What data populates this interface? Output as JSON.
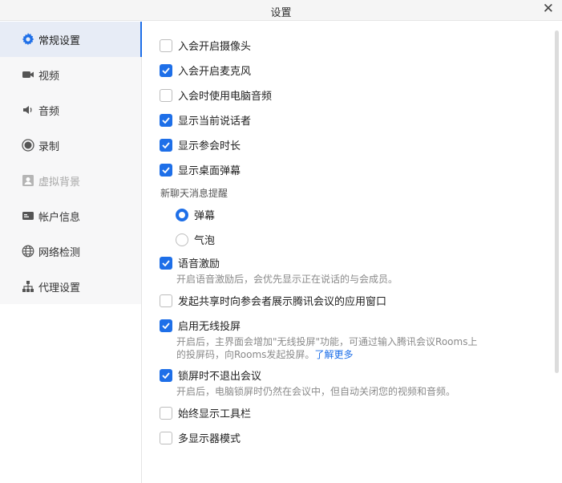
{
  "window": {
    "title": "设置"
  },
  "sidebar": {
    "items": [
      {
        "label": "常规设置",
        "icon": "gear-icon",
        "active": true
      },
      {
        "label": "视频",
        "icon": "video-camera-icon"
      },
      {
        "label": "音频",
        "icon": "speaker-icon"
      },
      {
        "label": "录制",
        "icon": "record-icon"
      },
      {
        "label": "虚拟背景",
        "icon": "virtual-background-icon",
        "disabled": true
      },
      {
        "label": "帐户信息",
        "icon": "account-card-icon"
      },
      {
        "label": "网络检测",
        "icon": "globe-icon"
      },
      {
        "label": "代理设置",
        "icon": "network-proxy-icon"
      }
    ]
  },
  "settings": {
    "join_camera": {
      "label": "入会开启摄像头",
      "checked": false
    },
    "join_mic": {
      "label": "入会开启麦克风",
      "checked": true
    },
    "use_pc_audio": {
      "label": "入会时使用电脑音频",
      "checked": false
    },
    "show_speaker": {
      "label": "显示当前说话者",
      "checked": true
    },
    "show_duration": {
      "label": "显示参会时长",
      "checked": true
    },
    "show_danmaku": {
      "label": "显示桌面弹幕",
      "checked": true
    },
    "chat_notify": {
      "group_label": "新聊天消息提醒",
      "options": [
        {
          "label": "弹幕",
          "selected": true
        },
        {
          "label": "气泡",
          "selected": false
        }
      ]
    },
    "voice_excite": {
      "label": "语音激励",
      "checked": true,
      "desc": "开启语音激励后，会优先显示正在说话的与会成员。"
    },
    "share_app_window": {
      "label": "发起共享时向参会者展示腾讯会议的应用窗口",
      "checked": false
    },
    "wireless_screen": {
      "label": "启用无线投屏",
      "checked": true,
      "desc_line1": "开启后，主界面会增加\"无线投屏\"功能，可通过输入腾讯会议Rooms上",
      "desc_line2": "的投屏码，向Rooms发起投屏。",
      "link": "了解更多"
    },
    "lock_screen": {
      "label": "锁屏时不退出会议",
      "checked": true,
      "desc": "开启后，电脑锁屏时仍然在会议中，但自动关闭您的视频和音频。"
    },
    "always_toolbar": {
      "label": "始终显示工具栏",
      "checked": false
    },
    "multi_display": {
      "label": "多显示器模式",
      "checked": false
    }
  },
  "colors": {
    "accent": "#1e6fe8",
    "sidebar_active": "#e7ecf6"
  }
}
